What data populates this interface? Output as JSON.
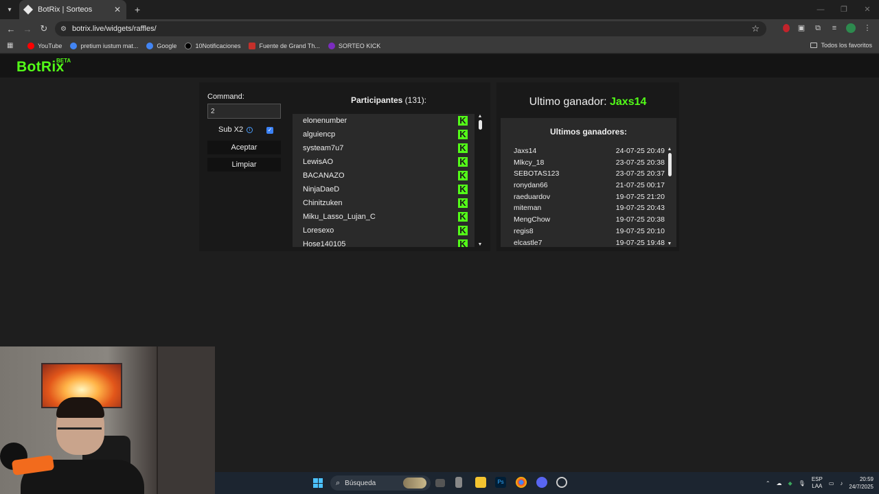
{
  "browser": {
    "tab_title": "BotRix | Sorteos",
    "url": "botrix.live/widgets/raffles/",
    "bookmarks": [
      {
        "label": "YouTube",
        "color": "#ff0000"
      },
      {
        "label": "pretium iustum mat...",
        "color": "#4285f4"
      },
      {
        "label": "Google",
        "color": "#4285f4"
      },
      {
        "label": "10Notificaciones",
        "color": "#000000"
      },
      {
        "label": "Fuente de Grand Th...",
        "color": "#c4302b"
      },
      {
        "label": "SORTEO KICK",
        "color": "#7b2cbf"
      }
    ],
    "bookmarks_folder": "Todos los favoritos"
  },
  "site": {
    "logo": "BotRix",
    "logo_badge": "BETA"
  },
  "raffle": {
    "command_label": "Command:",
    "command_value": "2",
    "sub_label": "Sub X2",
    "sub_checked": true,
    "accept_label": "Aceptar",
    "clear_label": "Limpiar",
    "participants_title": "Participantes",
    "participants_count": "(131):",
    "participants": [
      "elonenumber",
      "alguiencp",
      "systeam7u7",
      "LewisAO",
      "BACANAZO",
      "NinjaDaeD",
      "Chinitzuken",
      "Miku_Lasso_Lujan_C",
      "Loresexo",
      "Hose140105"
    ],
    "platform_badge": "K"
  },
  "winners": {
    "last_winner_label": "Ultimo ganador:",
    "last_winner_name": "Jaxs14",
    "list_title": "Ultimos ganadores:",
    "list": [
      {
        "name": "Jaxs14",
        "date": "24-07-25 20:49"
      },
      {
        "name": "Mlkcy_18",
        "date": "23-07-25 20:38"
      },
      {
        "name": "SEBOTAS123",
        "date": "23-07-25 20:37"
      },
      {
        "name": "ronydan66",
        "date": "21-07-25 00:17"
      },
      {
        "name": "raeduardov",
        "date": "19-07-25 21:20"
      },
      {
        "name": "miteman",
        "date": "19-07-25 20:43"
      },
      {
        "name": "MengChow",
        "date": "19-07-25 20:38"
      },
      {
        "name": "regis8",
        "date": "19-07-25 20:10"
      },
      {
        "name": "elcastle7",
        "date": "19-07-25 19:48"
      }
    ]
  },
  "taskbar": {
    "search_placeholder": "Búsqueda",
    "lang_top": "ESP",
    "lang_bottom": "LAA",
    "time": "20:59",
    "date": "24/7/2025"
  },
  "colors": {
    "accent_green": "#53fc18",
    "panel_bg": "#191919",
    "list_bg": "#2a2a2a"
  }
}
